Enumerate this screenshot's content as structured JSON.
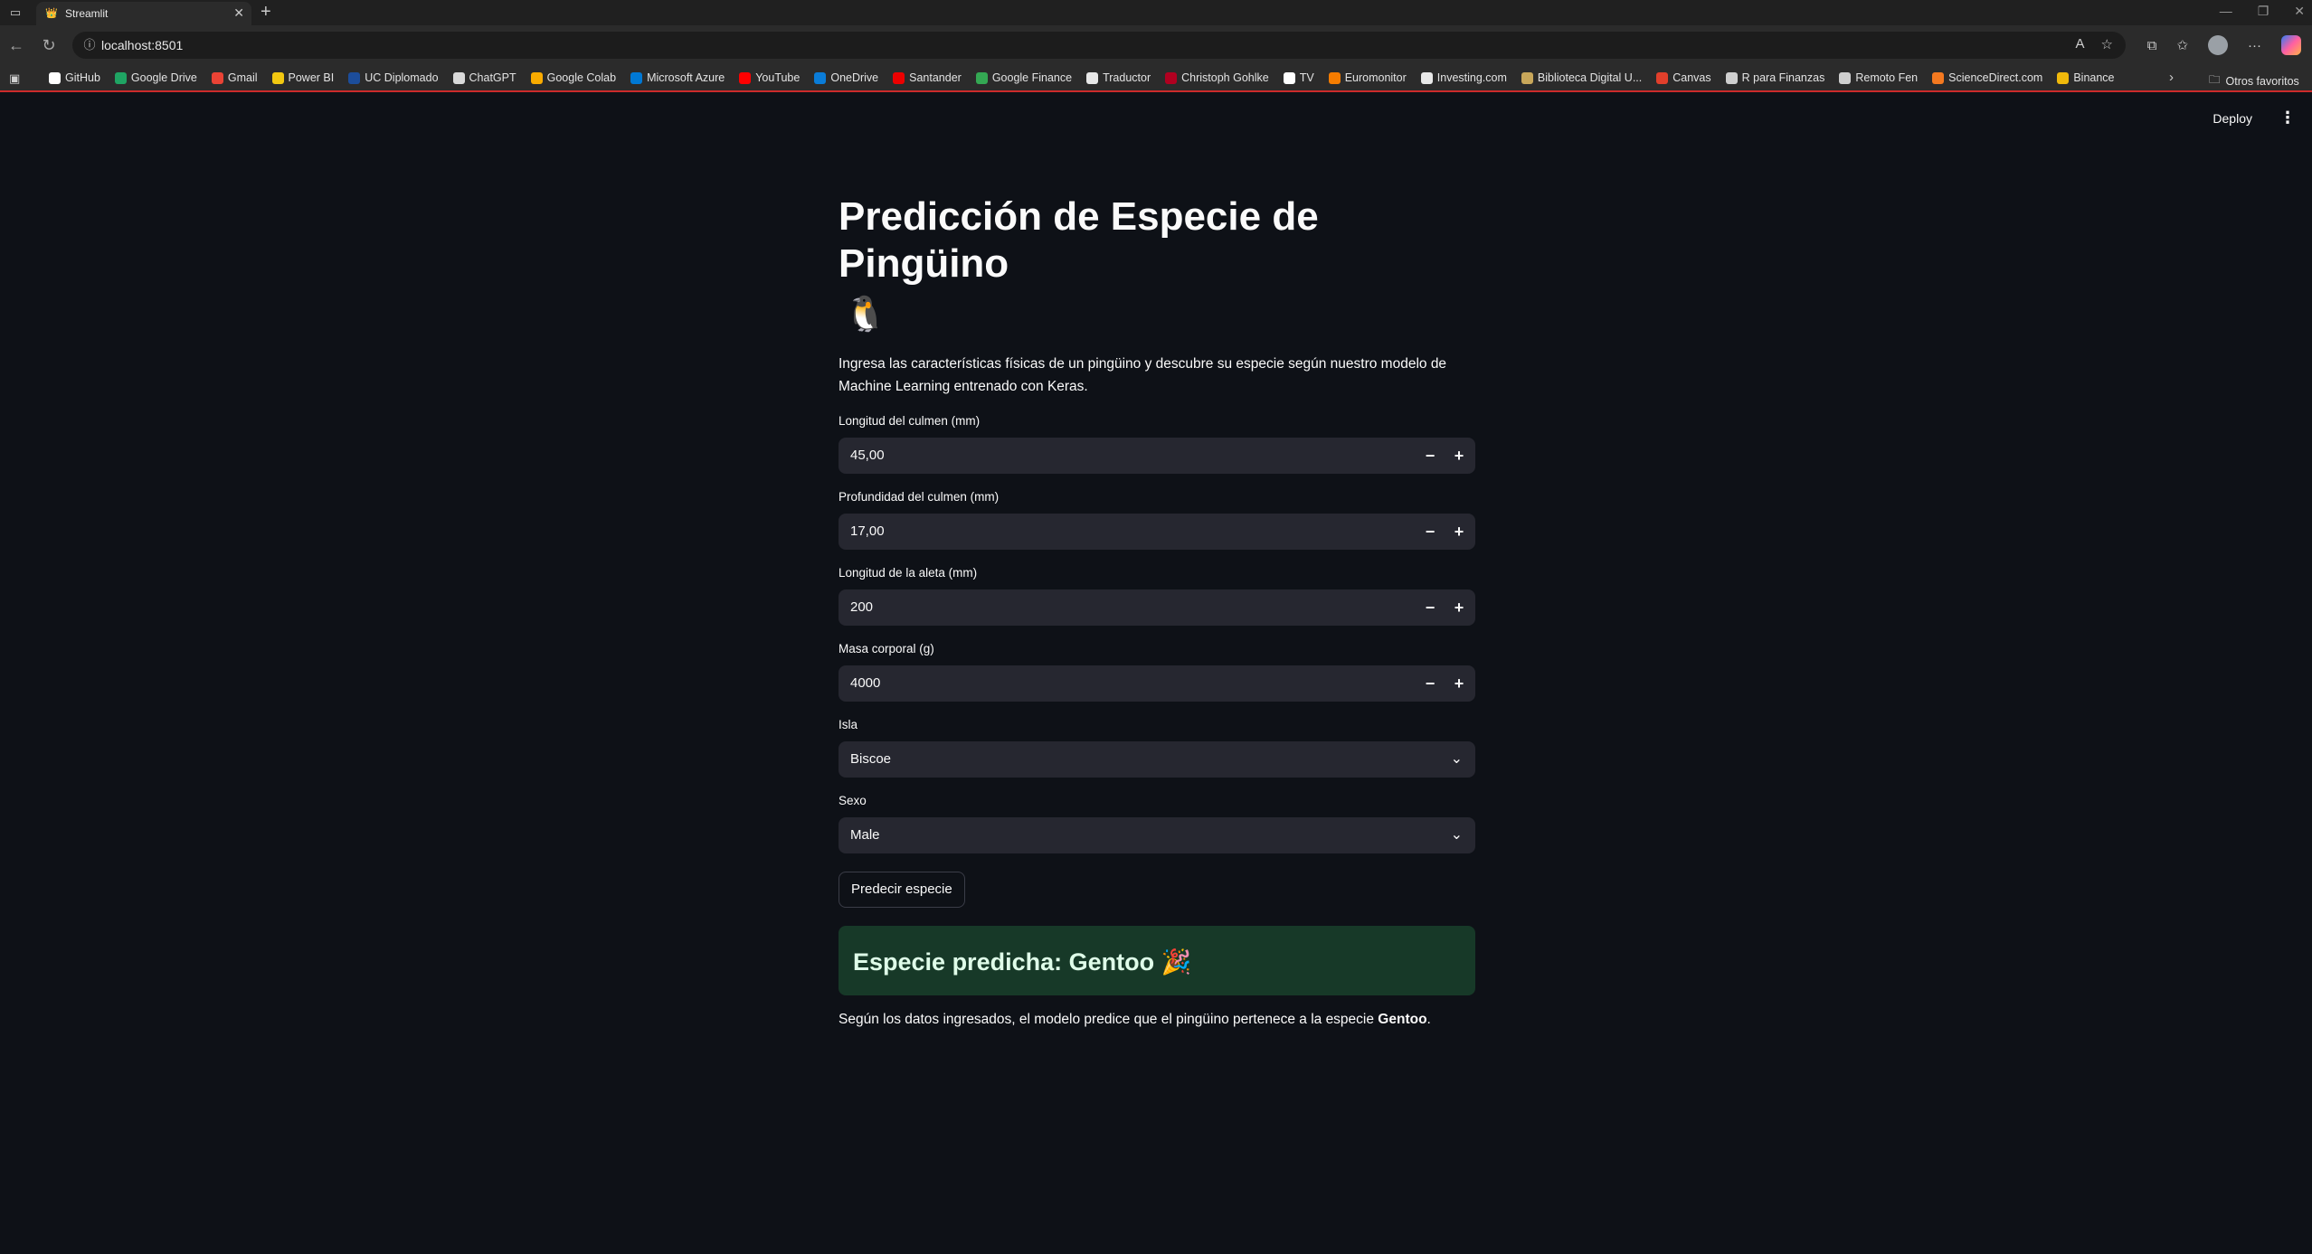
{
  "browser": {
    "tab_title": "Streamlit",
    "url": "localhost:8501",
    "bookmarks": [
      {
        "label": "GitHub",
        "color": "#ffffff"
      },
      {
        "label": "Google Drive",
        "color": "#1fa463"
      },
      {
        "label": "Gmail",
        "color": "#ea4335"
      },
      {
        "label": "Power BI",
        "color": "#f2c811"
      },
      {
        "label": "UC Diplomado",
        "color": "#1c4d9b"
      },
      {
        "label": "ChatGPT",
        "color": "#d9d9d9"
      },
      {
        "label": "Google Colab",
        "color": "#f9ab00"
      },
      {
        "label": "Microsoft Azure",
        "color": "#0078d4"
      },
      {
        "label": "YouTube",
        "color": "#ff0000"
      },
      {
        "label": "OneDrive",
        "color": "#0a7cd8"
      },
      {
        "label": "Santander",
        "color": "#ec0000"
      },
      {
        "label": "Google Finance",
        "color": "#34a853"
      },
      {
        "label": "Traductor",
        "color": "#e8e8e8"
      },
      {
        "label": "Christoph Gohlke",
        "color": "#b00020"
      },
      {
        "label": "TV",
        "color": "#ffffff"
      },
      {
        "label": "Euromonitor",
        "color": "#f57c00"
      },
      {
        "label": "Investing.com",
        "color": "#e8e8e8"
      },
      {
        "label": "Biblioteca Digital U...",
        "color": "#c8a75a"
      },
      {
        "label": "Canvas",
        "color": "#e13f2b"
      },
      {
        "label": "R para Finanzas",
        "color": "#cfcfcf"
      },
      {
        "label": "Remoto Fen",
        "color": "#cfcfcf"
      },
      {
        "label": "ScienceDirect.com",
        "color": "#f47920"
      },
      {
        "label": "Binance",
        "color": "#f0b90b"
      }
    ],
    "other_favorites": "Otros favoritos"
  },
  "header": {
    "deploy_label": "Deploy"
  },
  "page": {
    "title": "Predicción de Especie de Pingüino",
    "title_emoji": "🐧",
    "intro": "Ingresa las características físicas de un pingüino y descubre su especie según nuestro modelo de Machine Learning entrenado con Keras."
  },
  "inputs": {
    "culmen_length": {
      "label": "Longitud del culmen (mm)",
      "value": "45,00"
    },
    "culmen_depth": {
      "label": "Profundidad del culmen (mm)",
      "value": "17,00"
    },
    "flipper_length": {
      "label": "Longitud de la aleta (mm)",
      "value": "200"
    },
    "body_mass": {
      "label": "Masa corporal (g)",
      "value": "4000"
    },
    "island": {
      "label": "Isla",
      "value": "Biscoe"
    },
    "sex": {
      "label": "Sexo",
      "value": "Male"
    }
  },
  "predict_button": "Predecir especie",
  "result": {
    "heading": "Especie predicha: Gentoo 🎉",
    "sentence_prefix": "Según los datos ingresados, el modelo predice que el pingüino pertenece a la especie ",
    "species": "Gentoo",
    "sentence_suffix": "."
  },
  "colors": {
    "background": "#0e1117",
    "input_bg": "#262730",
    "success_bg": "#173928",
    "success_text": "#dffde9"
  }
}
